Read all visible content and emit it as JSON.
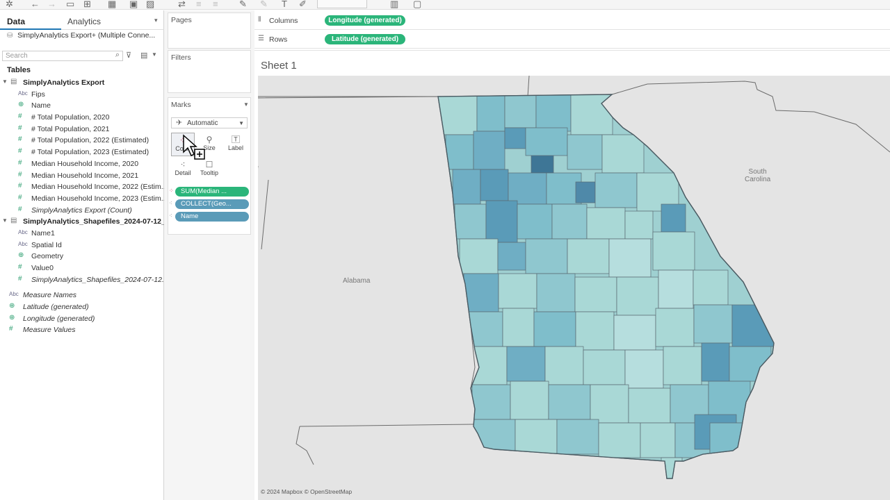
{
  "toolbar": {
    "icons": [
      "tableau-logo-icon",
      "back-icon",
      "forward-icon",
      "save-icon",
      "new-datasource-icon",
      "new-sheet-icon",
      "duplicate-icon",
      "clear-icon",
      "swap-icon",
      "sort-icon",
      "highlight-icon",
      "format-icon",
      "label-icon",
      "pin-icon",
      "show-me-icon",
      "presentation-icon"
    ]
  },
  "data_pane": {
    "tab_data": "Data",
    "tab_analytics": "Analytics",
    "connection_label": "SimplyAnalytics Export+ (Multiple Conne...",
    "search_placeholder": "Search",
    "tables_title": "Tables",
    "datasource1": {
      "name": "SimplyAnalytics Export",
      "fields": [
        {
          "type": "Abc",
          "kind": "text",
          "name": "Fips",
          "italic": false
        },
        {
          "type": "⊕",
          "kind": "geo",
          "name": "Name",
          "italic": false
        },
        {
          "type": "#",
          "kind": "num",
          "name": "# Total Population, 2020",
          "italic": false
        },
        {
          "type": "#",
          "kind": "num",
          "name": "# Total Population, 2021",
          "italic": false
        },
        {
          "type": "#",
          "kind": "num",
          "name": "# Total Population, 2022 (Estimated)",
          "italic": false
        },
        {
          "type": "#",
          "kind": "num",
          "name": "# Total Population, 2023 (Estimated)",
          "italic": false
        },
        {
          "type": "#",
          "kind": "num",
          "name": "Median Household Income, 2020",
          "italic": false
        },
        {
          "type": "#",
          "kind": "num",
          "name": "Median Household Income, 2021",
          "italic": false
        },
        {
          "type": "#",
          "kind": "num",
          "name": "Median Household Income, 2022 (Estim...",
          "italic": false
        },
        {
          "type": "#",
          "kind": "num",
          "name": "Median Household Income, 2023 (Estim...",
          "italic": false
        },
        {
          "type": "#",
          "kind": "num",
          "name": "SimplyAnalytics Export (Count)",
          "italic": true
        }
      ]
    },
    "datasource2": {
      "name": "SimplyAnalytics_Shapefiles_2024-07-12_...",
      "fields": [
        {
          "type": "Abc",
          "kind": "text",
          "name": "Name1",
          "italic": false
        },
        {
          "type": "Abc",
          "kind": "text",
          "name": "Spatial Id",
          "italic": false
        },
        {
          "type": "⊕",
          "kind": "geo",
          "name": "Geometry",
          "italic": false
        },
        {
          "type": "#",
          "kind": "num",
          "name": "Value0",
          "italic": false
        },
        {
          "type": "#",
          "kind": "num",
          "name": "SimplyAnalytics_Shapefiles_2024-07-12...",
          "italic": true
        }
      ]
    },
    "extra_fields": [
      {
        "type": "Abc",
        "kind": "text",
        "name": "Measure Names",
        "italic": true
      },
      {
        "type": "⊕",
        "kind": "geo",
        "name": "Latitude (generated)",
        "italic": true
      },
      {
        "type": "⊕",
        "kind": "geo",
        "name": "Longitude (generated)",
        "italic": true
      },
      {
        "type": "#",
        "kind": "num",
        "name": "Measure Values",
        "italic": true
      }
    ]
  },
  "shelves": {
    "pages_label": "Pages",
    "filters_label": "Filters",
    "marks_label": "Marks",
    "mark_type": "Automatic",
    "buttons": {
      "color": "Color",
      "size": "Size",
      "label": "Label",
      "detail": "Detail",
      "tooltip": "Tooltip"
    },
    "marks_pills": [
      "SUM(Median ...",
      "COLLECT(Geo...",
      "Name"
    ],
    "columns_label": "Columns",
    "rows_label": "Rows",
    "columns_pill": "Longitude (generated)",
    "rows_pill": "Latitude (generated)"
  },
  "sheet": {
    "title": "Sheet 1",
    "map_labels": {
      "south_carolina": "South\nCarolina",
      "alabama": "Alabama"
    },
    "attribution": "© 2024 Mapbox © OpenStreetMap",
    "colors": {
      "light": "#a9d8d6",
      "mid": "#7fbecb",
      "dark": "#5a9bb8",
      "darkest": "#3e7696",
      "border": "#4a5a62"
    }
  }
}
